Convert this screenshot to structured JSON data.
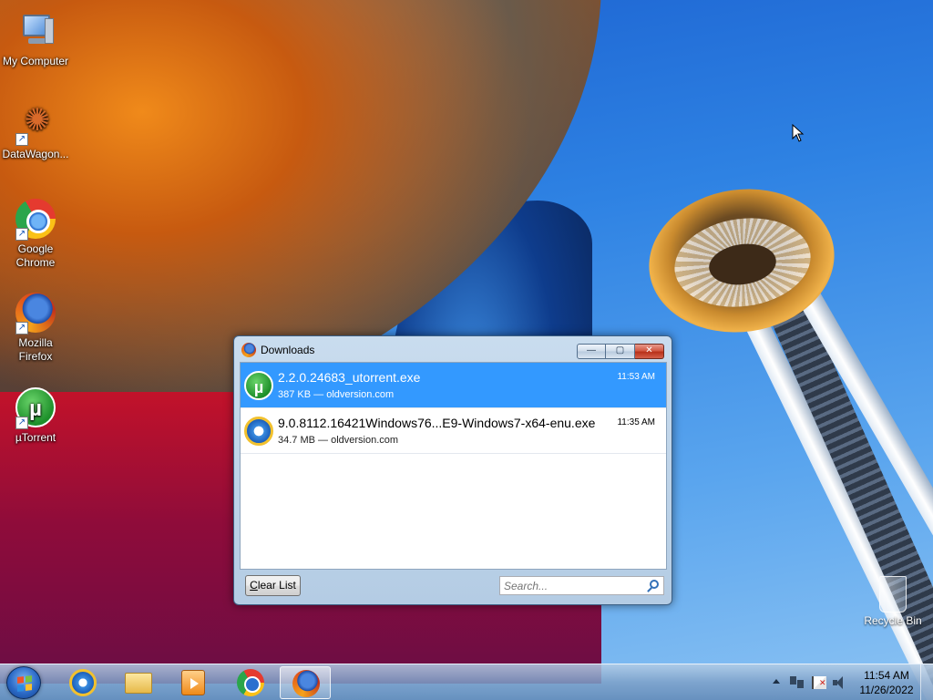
{
  "desktop": {
    "icons": [
      {
        "label": "My Computer"
      },
      {
        "label": "DataWagon..."
      },
      {
        "label": "Google Chrome"
      },
      {
        "label": "Mozilla Firefox"
      },
      {
        "label": "µTorrent"
      }
    ],
    "recycle_bin": {
      "label": "Recycle Bin"
    }
  },
  "downloads_window": {
    "title": "Downloads",
    "buttons": {
      "minimize": "—",
      "maximize": "▢",
      "close": "✕"
    },
    "items": [
      {
        "name": "2.2.0.24683_utorrent.exe",
        "meta": "387 KB — oldversion.com",
        "time": "11:53 AM",
        "icon": "utorrent-icon",
        "selected": true
      },
      {
        "name": "9.0.8112.16421Windows76...E9-Windows7-x64-enu.exe",
        "meta": "34.7 MB — oldversion.com",
        "time": "11:35 AM",
        "icon": "internet-explorer-icon",
        "selected": false
      }
    ],
    "clear_list": {
      "prefix": "C",
      "rest": "lear List"
    },
    "search": {
      "placeholder": "Search..."
    }
  },
  "taskbar": {
    "apps": [
      {
        "name": "internet-explorer-icon"
      },
      {
        "name": "windows-explorer-icon"
      },
      {
        "name": "media-player-icon"
      },
      {
        "name": "google-chrome-icon"
      },
      {
        "name": "firefox-icon",
        "active": true
      }
    ],
    "clock": {
      "time": "11:54 AM",
      "date": "11/26/2022"
    }
  },
  "colors": {
    "selection": "#3399ff",
    "close_button": "#c8432c"
  }
}
